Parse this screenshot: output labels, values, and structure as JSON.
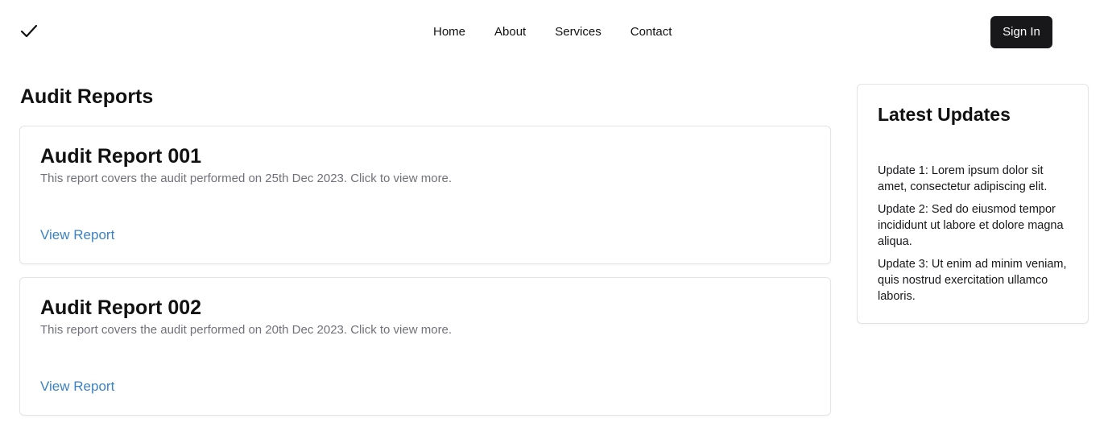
{
  "header": {
    "logo_icon": "checkmark-icon",
    "nav": [
      "Home",
      "About",
      "Services",
      "Contact"
    ],
    "signin_label": "Sign In"
  },
  "main": {
    "title": "Audit Reports",
    "reports": [
      {
        "title": "Audit Report 001",
        "description": "This report covers the audit performed on 25th Dec 2023. Click to view more.",
        "link_label": "View Report"
      },
      {
        "title": "Audit Report 002",
        "description": "This report covers the audit performed on 20th Dec 2023. Click to view more.",
        "link_label": "View Report"
      }
    ]
  },
  "sidebar": {
    "title": "Latest Updates",
    "updates": [
      "Update 1: Lorem ipsum dolor sit amet, consectetur adipiscing elit.",
      "Update 2: Sed do eiusmod tempor incididunt ut labore et dolore magna aliqua.",
      "Update 3: Ut enim ad minim veniam, quis nostrud exercitation ullamco laboris."
    ]
  },
  "colors": {
    "button_bg": "#18181b",
    "link": "#3b82c4",
    "muted_text": "#71717a",
    "border": "#e4e4e7"
  }
}
